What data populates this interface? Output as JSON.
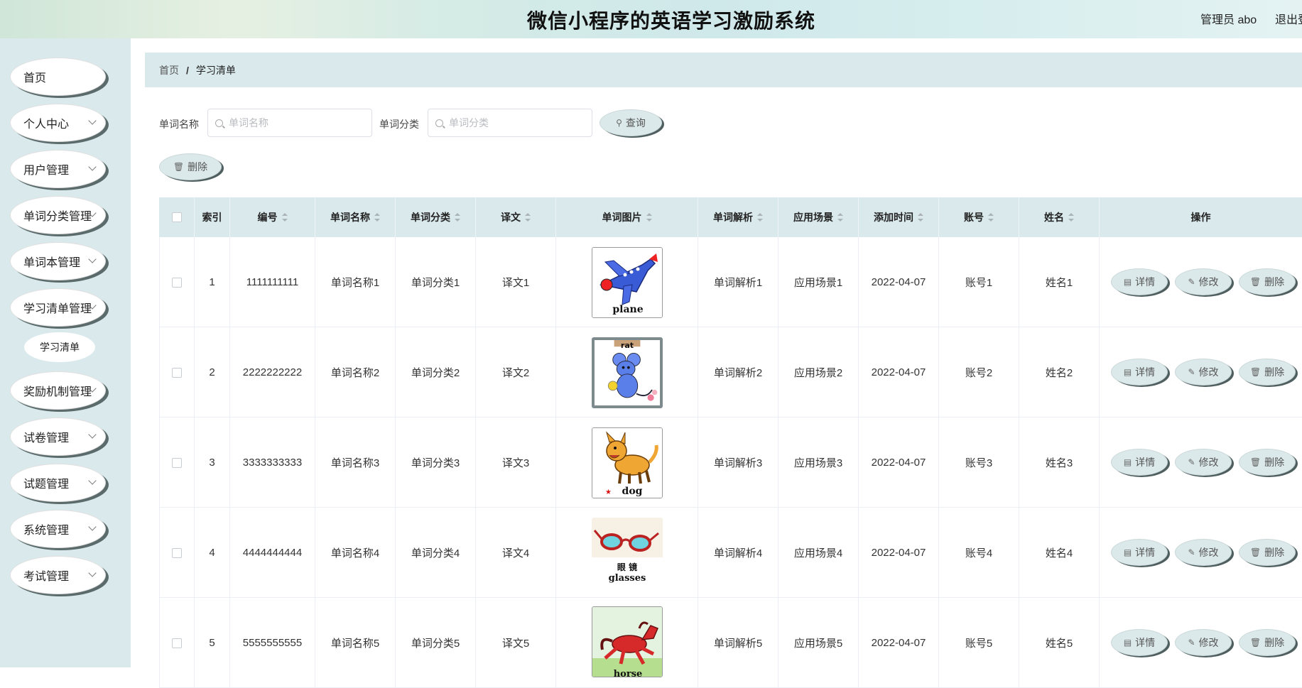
{
  "header": {
    "title": "微信小程序的英语学习激励系统",
    "admin": "管理员 abo",
    "logout": "退出登录"
  },
  "sidebar": {
    "items": [
      {
        "label": "首页",
        "has_children": false
      },
      {
        "label": "个人中心",
        "has_children": true
      },
      {
        "label": "用户管理",
        "has_children": true
      },
      {
        "label": "单词分类管理",
        "has_children": true
      },
      {
        "label": "单词本管理",
        "has_children": true
      },
      {
        "label": "学习清单管理",
        "has_children": true
      },
      {
        "label": "奖励机制管理",
        "has_children": true
      },
      {
        "label": "试卷管理",
        "has_children": true
      },
      {
        "label": "试题管理",
        "has_children": true
      },
      {
        "label": "系统管理",
        "has_children": true
      },
      {
        "label": "考试管理",
        "has_children": true
      }
    ],
    "submenu": {
      "label": "学习清单"
    }
  },
  "breadcrumb": {
    "home": "首页",
    "separator": "/",
    "current": "学习清单"
  },
  "search": {
    "word_name_label": "单词名称",
    "word_name_placeholder": "单词名称",
    "word_category_label": "单词分类",
    "word_category_placeholder": "单词分类",
    "query_button": "查询",
    "delete_button": "删除"
  },
  "table": {
    "columns": [
      "索引",
      "编号",
      "单词名称",
      "单词分类",
      "译文",
      "单词图片",
      "单词解析",
      "应用场景",
      "添加时间",
      "账号",
      "姓名",
      "操作"
    ],
    "rows": [
      {
        "index": "1",
        "code": "1111111111",
        "word_name": "单词名称1",
        "category": "单词分类1",
        "translation": "译文1",
        "image_text": "plane",
        "analysis": "单词解析1",
        "scene": "应用场景1",
        "date": "2022-04-07",
        "account": "账号1",
        "name": "姓名1"
      },
      {
        "index": "2",
        "code": "2222222222",
        "word_name": "单词名称2",
        "category": "单词分类2",
        "translation": "译文2",
        "image_text": "rat",
        "analysis": "单词解析2",
        "scene": "应用场景2",
        "date": "2022-04-07",
        "account": "账号2",
        "name": "姓名2"
      },
      {
        "index": "3",
        "code": "3333333333",
        "word_name": "单词名称3",
        "category": "单词分类3",
        "translation": "译文3",
        "image_text": "dog",
        "analysis": "单词解析3",
        "scene": "应用场景3",
        "date": "2022-04-07",
        "account": "账号3",
        "name": "姓名3"
      },
      {
        "index": "4",
        "code": "4444444444",
        "word_name": "单词名称4",
        "category": "单词分类4",
        "translation": "译文4",
        "image_text": "glasses",
        "image_text_cn": "眼 镜",
        "analysis": "单词解析4",
        "scene": "应用场景4",
        "date": "2022-04-07",
        "account": "账号4",
        "name": "姓名4"
      },
      {
        "index": "5",
        "code": "5555555555",
        "word_name": "单词名称5",
        "category": "单词分类5",
        "translation": "译文5",
        "image_text": "horse",
        "analysis": "单词解析5",
        "scene": "应用场景5",
        "date": "2022-04-07",
        "account": "账号5",
        "name": "姓名5"
      }
    ],
    "actions": {
      "detail": "详情",
      "edit": "修改",
      "delete": "删除"
    }
  },
  "colors": {
    "accent_bg": "#d9e9ec",
    "button_bg": "#dce9ea",
    "button_shadow": "#4f5f60"
  }
}
